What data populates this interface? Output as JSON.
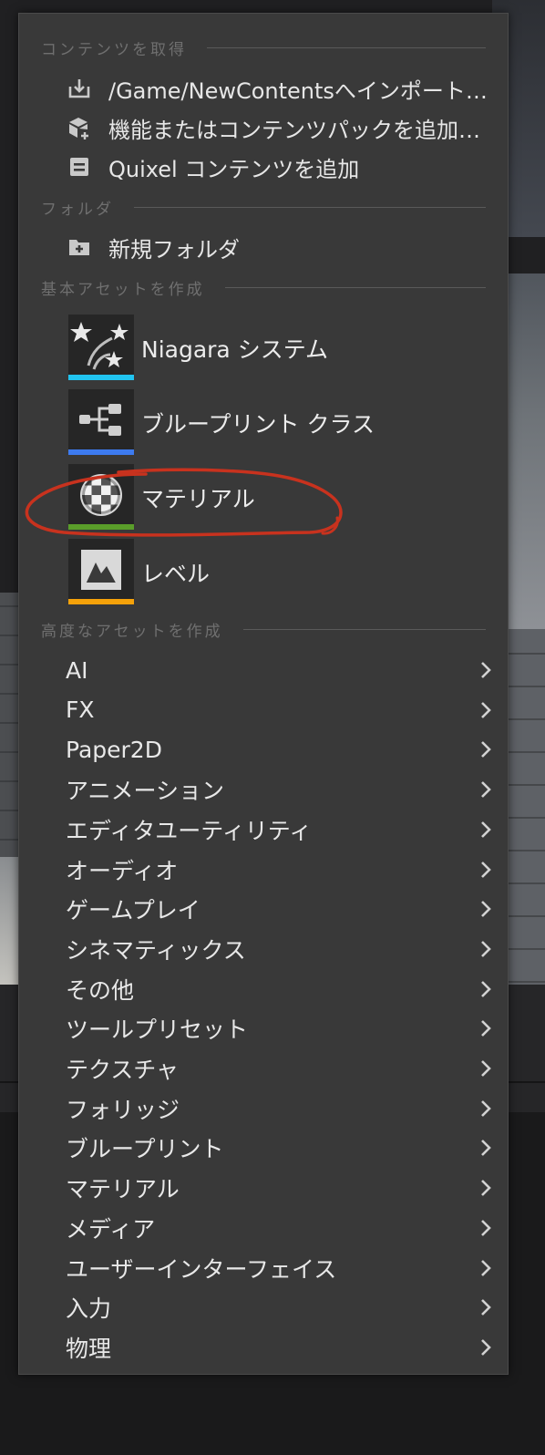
{
  "sections": {
    "get_content": "コンテンツを取得",
    "folder": "フォルダ",
    "basic_assets": "基本アセットを作成",
    "advanced_assets": "高度なアセットを作成"
  },
  "get_content_items": [
    {
      "label": "/Game/NewContentsへインポート…",
      "icon": "import-icon"
    },
    {
      "label": "機能またはコンテンツパックを追加…",
      "icon": "add-feature-pack-icon"
    },
    {
      "label": "Quixel コンテンツを追加",
      "icon": "quixel-icon"
    }
  ],
  "folder_items": [
    {
      "label": "新規フォルダ",
      "icon": "new-folder-icon"
    }
  ],
  "basic_assets": [
    {
      "label": "Niagara システム",
      "icon": "niagara-system-icon",
      "color": "#21c4f0"
    },
    {
      "label": "ブループリント クラス",
      "icon": "blueprint-class-icon",
      "color": "#3d7bf0"
    },
    {
      "label": "マテリアル",
      "icon": "material-icon",
      "color": "#5a9e2a"
    },
    {
      "label": "レベル",
      "icon": "level-icon",
      "color": "#f5a20a"
    }
  ],
  "advanced_assets": [
    "AI",
    "FX",
    "Paper2D",
    "アニメーション",
    "エディタユーティリティ",
    "オーディオ",
    "ゲームプレイ",
    "シネマティックス",
    "その他",
    "ツールプリセット",
    "テクスチャ",
    "フォリッジ",
    "ブループリント",
    "マテリアル",
    "メディア",
    "ユーザーインターフェイス",
    "入力",
    "物理"
  ],
  "colors": {
    "menu_bg": "#393939",
    "annotation": "#c8321e"
  }
}
